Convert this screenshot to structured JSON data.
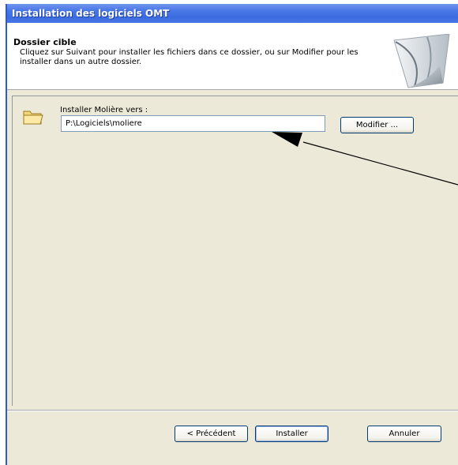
{
  "window": {
    "title": "Installation des logiciels OMT"
  },
  "header": {
    "title": "Dossier cible",
    "description": "Cliquez sur Suivant pour installer les fichiers dans ce dossier, ou sur Modifier pour les installer dans un autre dossier."
  },
  "content": {
    "install_label": "Installer Molière vers :",
    "path_value": "P:\\Logiciels\\moliere",
    "modify_label": "Modifier ..."
  },
  "footer": {
    "prev_label": "< Précédent",
    "install_label": "Installer",
    "cancel_label": "Annuler"
  },
  "icons": {
    "folder": "folder-icon",
    "header_graphic": "wizard-header-graphic",
    "arrow": "annotation-arrow"
  },
  "colors": {
    "titlebar": "#3b6ce0",
    "dialog_bg": "#ece9d8",
    "header_bg": "#ffffff",
    "button_border": "#003c74"
  }
}
